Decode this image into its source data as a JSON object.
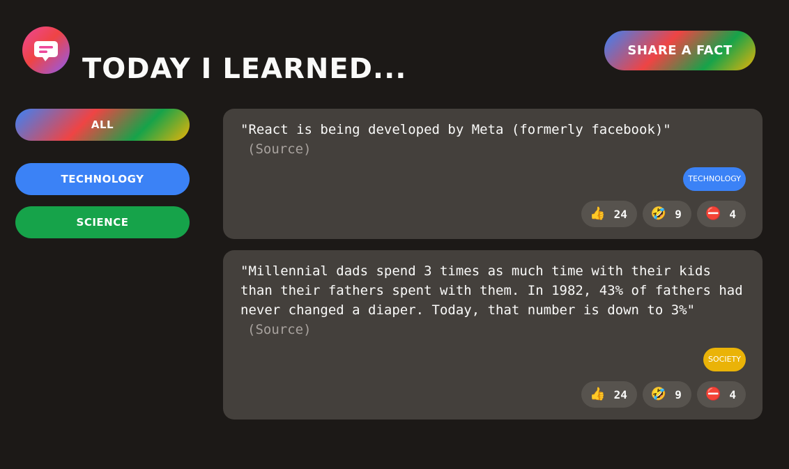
{
  "header": {
    "title": "Today I Learned...",
    "share_label": "Share a fact"
  },
  "colors": {
    "background": "#1c1917",
    "card": "#44403c",
    "vote_button": "#57534e",
    "technology": "#3b82f6",
    "science": "#16a34a",
    "society": "#eab308"
  },
  "sidebar": {
    "items": [
      {
        "label": "All"
      },
      {
        "label": "Technology"
      },
      {
        "label": "Science"
      }
    ]
  },
  "facts": [
    {
      "text": "\"React is being developed by Meta (formerly facebook)\"",
      "source_label": "(Source)",
      "category": "technology",
      "category_color": "#3b82f6",
      "votes": {
        "interesting": {
          "icon": "👍",
          "count": "24"
        },
        "mindblowing": {
          "icon": "🤣",
          "count": "9"
        },
        "false": {
          "icon": "⛔",
          "count": "4"
        }
      }
    },
    {
      "text": "\"Millennial dads spend 3 times as much time with their kids than their fathers spent with them. In 1982, 43% of fathers had never changed a diaper. Today, that number is down to 3%\"",
      "source_label": "(Source)",
      "category": "society",
      "category_color": "#eab308",
      "votes": {
        "interesting": {
          "icon": "👍",
          "count": "24"
        },
        "mindblowing": {
          "icon": "🤣",
          "count": "9"
        },
        "false": {
          "icon": "⛔",
          "count": "4"
        }
      }
    }
  ]
}
